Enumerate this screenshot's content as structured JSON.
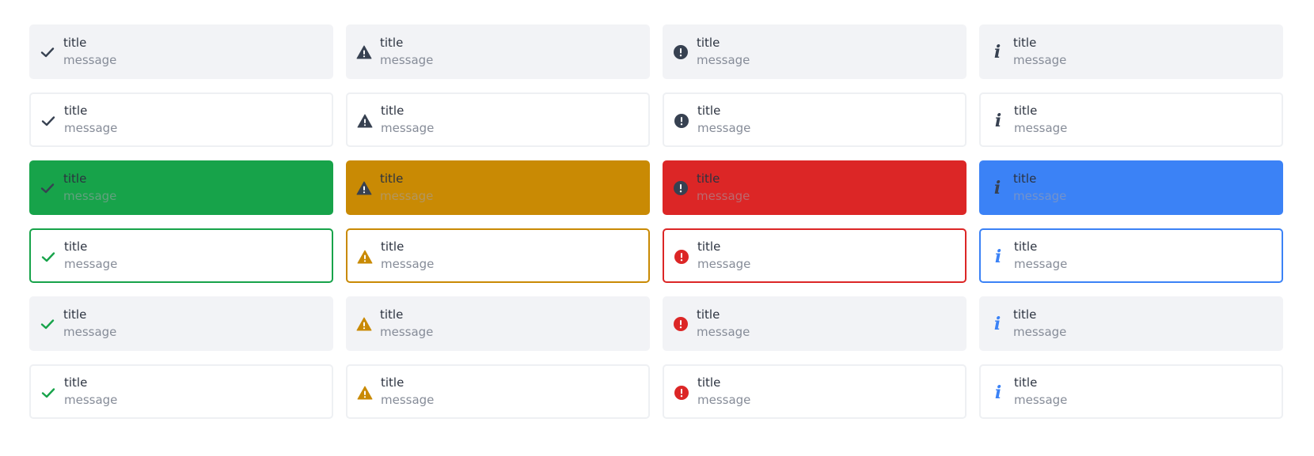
{
  "colors": {
    "success": "#17a34a",
    "warning": "#c98a04",
    "error": "#dc2626",
    "info": "#3b82f6",
    "neutral": "#374151",
    "soft_bg": "#f2f3f6"
  },
  "types": [
    {
      "key": "success",
      "icon": "check-icon"
    },
    {
      "key": "warning",
      "icon": "warning-icon"
    },
    {
      "key": "error",
      "icon": "error-icon"
    },
    {
      "key": "info",
      "icon": "info-icon"
    }
  ],
  "variants": [
    {
      "name": "soft-neutral"
    },
    {
      "name": "outline-neutral"
    },
    {
      "name": "solid"
    },
    {
      "name": "outline-color"
    },
    {
      "name": "soft-color"
    },
    {
      "name": "outline-neutral-color-icon"
    }
  ],
  "alert": {
    "title": "title",
    "message": "message"
  }
}
